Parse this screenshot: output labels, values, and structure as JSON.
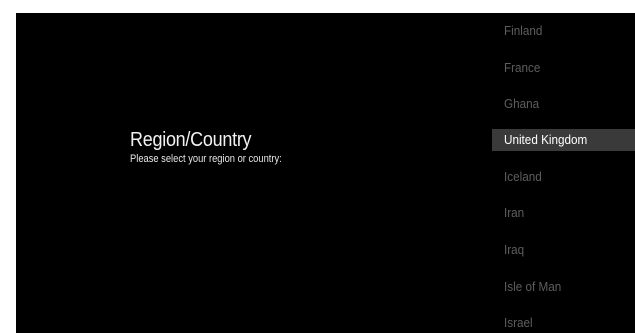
{
  "header": {
    "title": "Region/Country",
    "subtitle": "Please select your region or country:"
  },
  "country_list": {
    "selected": "United Kingdom",
    "items": [
      {
        "label": "Finland"
      },
      {
        "label": "France"
      },
      {
        "label": "Ghana"
      },
      {
        "label": "United Kingdom"
      },
      {
        "label": "Iceland"
      },
      {
        "label": "Iran"
      },
      {
        "label": "Iraq"
      },
      {
        "label": "Isle of Man"
      },
      {
        "label": "Israel"
      }
    ]
  },
  "colors": {
    "background": "#000000",
    "selected_row": "#3a3a3a",
    "unselected_text": "#5e5e5e",
    "selected_text": "#ffffff"
  }
}
